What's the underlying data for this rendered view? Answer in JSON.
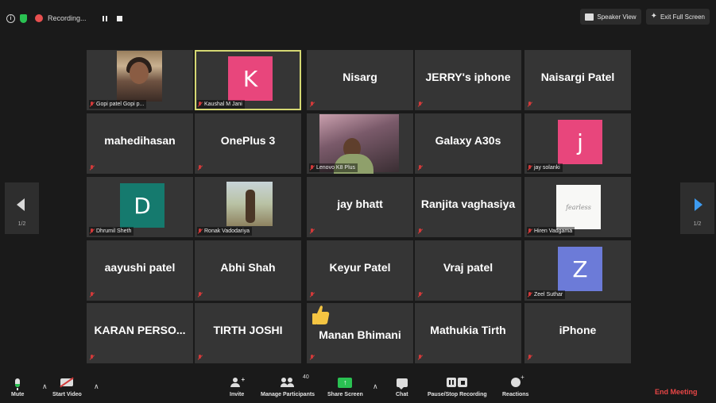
{
  "topbar": {
    "info_icon": "info-icon",
    "shield_icon": "shield-icon",
    "recording_label": "Recording...",
    "speaker_view_label": "Speaker View",
    "exit_fullscreen_label": "Exit Full Screen"
  },
  "participants": [
    {
      "name": "Gopi patel Gopi p...",
      "type": "photo",
      "label_only": true
    },
    {
      "name": "Kaushal M Jani",
      "type": "letter",
      "letter": "K",
      "color": "#e8467c",
      "active": true
    },
    {
      "name": "Nisarg",
      "type": "text"
    },
    {
      "name": "JERRY's iphone",
      "type": "text"
    },
    {
      "name": "Naisargi Patel",
      "type": "text"
    },
    {
      "name": "mahedihasan",
      "type": "text"
    },
    {
      "name": "OnePlus 3",
      "type": "text"
    },
    {
      "name": "Lenovo K8 Plus",
      "type": "photo",
      "label_only": true
    },
    {
      "name": "Galaxy A30s",
      "type": "text"
    },
    {
      "name": "jay solanki",
      "type": "letter",
      "letter": "j",
      "color": "#e8467c"
    },
    {
      "name": "Dhrumil Sheth",
      "type": "letter",
      "letter": "D",
      "color": "#157a6e"
    },
    {
      "name": "Ronak Vadodariya",
      "type": "photo",
      "label_only": true
    },
    {
      "name": "jay bhatt",
      "type": "text"
    },
    {
      "name": "Ranjita vaghasiya",
      "type": "text"
    },
    {
      "name": "Hiren Vadgama",
      "type": "photo",
      "label_only": true,
      "photo_text": "fearless"
    },
    {
      "name": "aayushi patel",
      "type": "text"
    },
    {
      "name": "Abhi Shah",
      "type": "text"
    },
    {
      "name": "Keyur Patel",
      "type": "text"
    },
    {
      "name": "Vraj patel",
      "type": "text"
    },
    {
      "name": "Zeel Suthar",
      "type": "letter",
      "letter": "Z",
      "color": "#6c7bd8"
    },
    {
      "name": "KARAN PERSO...",
      "type": "text"
    },
    {
      "name": "TIRTH JOSHI",
      "type": "text"
    },
    {
      "name": "Manan Bhimani",
      "type": "text",
      "reaction": "thumbs-up-icon"
    },
    {
      "name": "Mathukia Tirth",
      "type": "text"
    },
    {
      "name": "iPhone",
      "type": "text"
    }
  ],
  "pager": {
    "left_page": "1/2",
    "right_page": "1/2"
  },
  "toolbar": {
    "mute_label": "Mute",
    "start_video_label": "Start Video",
    "invite_label": "Invite",
    "manage_participants_label": "Manage Participants",
    "participant_count": "40",
    "share_screen_label": "Share Screen",
    "chat_label": "Chat",
    "pause_stop_recording_label": "Pause/Stop Recording",
    "reactions_label": "Reactions",
    "end_meeting_label": "End Meeting"
  }
}
